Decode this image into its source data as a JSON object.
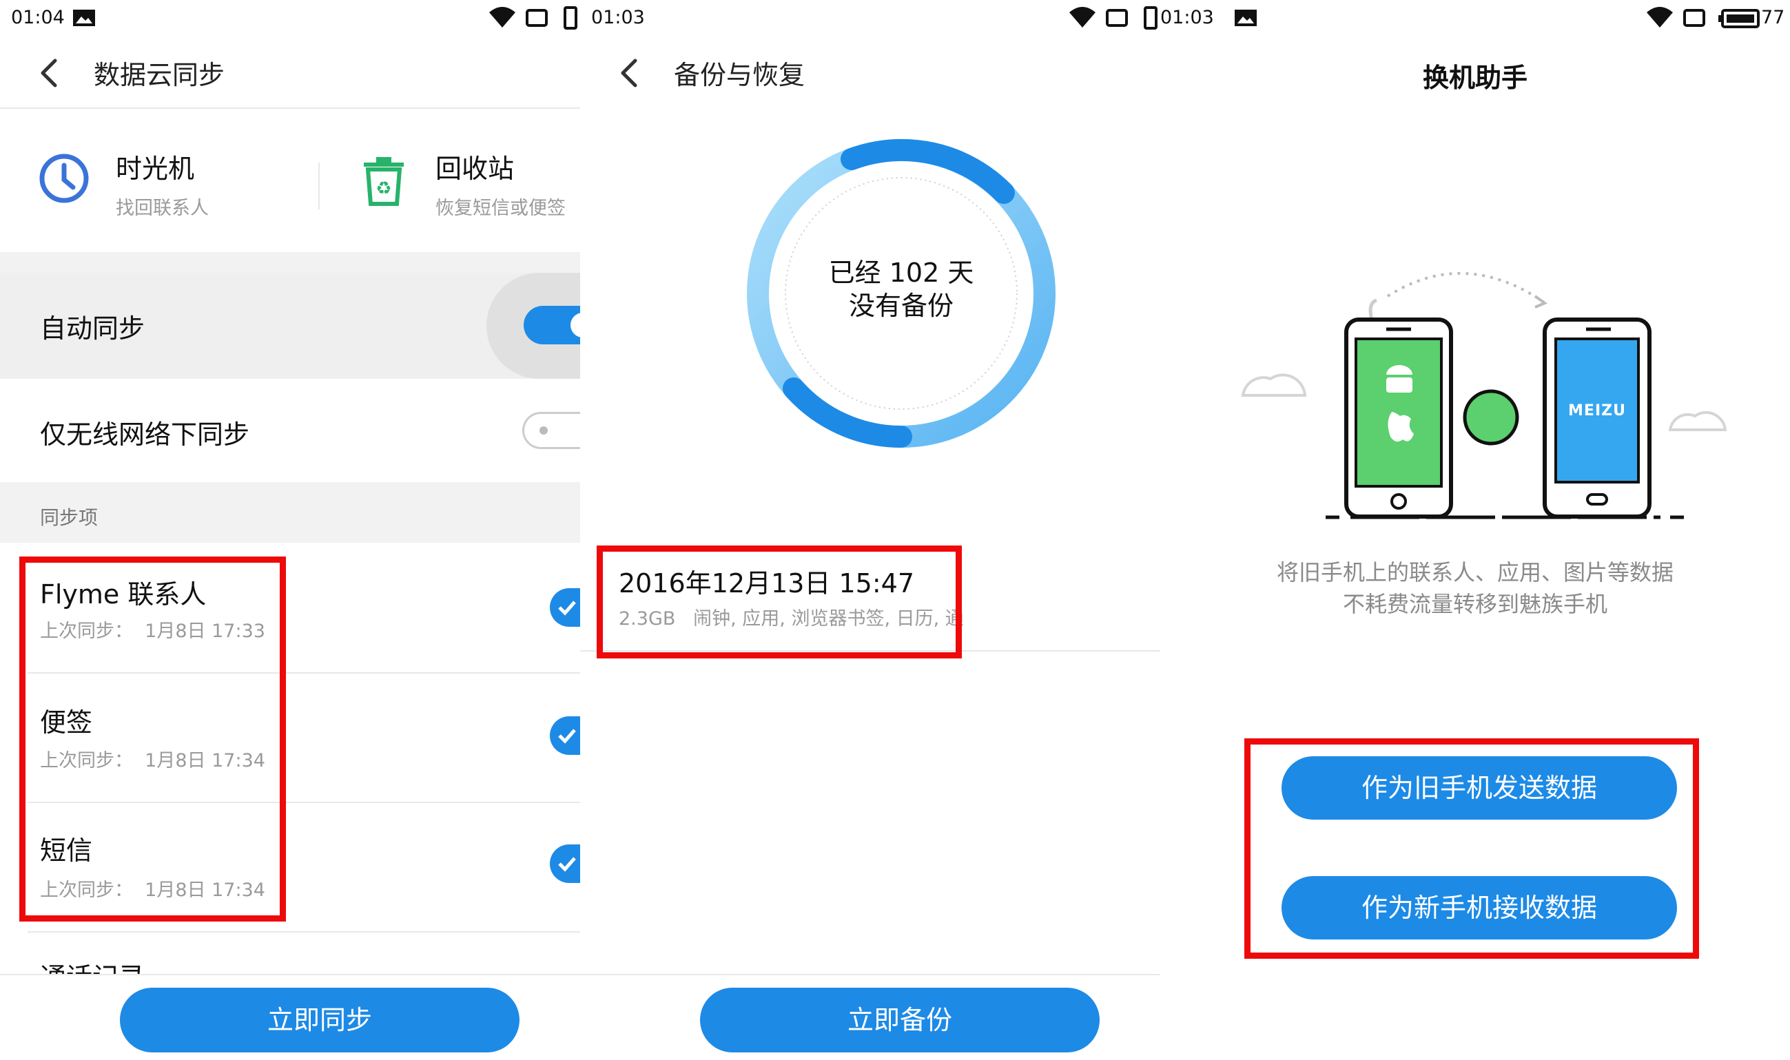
{
  "panel1": {
    "status_time": "01:04",
    "title": "数据云同步",
    "shortcuts": [
      {
        "title": "时光机",
        "subtitle": "找回联系人",
        "icon": "clock-icon"
      },
      {
        "title": "回收站",
        "subtitle": "恢复短信或便签",
        "icon": "recycle-bin-icon"
      }
    ],
    "auto_sync_label": "自动同步",
    "auto_sync_on": true,
    "wifi_only_label": "仅无线网络下同步",
    "wifi_only_on": false,
    "section_label": "同步项",
    "sync_items": [
      {
        "name": "Flyme 联系人",
        "prefix": "上次同步：",
        "time": "1月8日 17:33",
        "checked": true
      },
      {
        "name": "便签",
        "prefix": "上次同步：",
        "time": "1月8日 17:34",
        "checked": true
      },
      {
        "name": "短信",
        "prefix": "上次同步：",
        "time": "1月8日 17:34",
        "checked": true
      },
      {
        "name": "通话记录",
        "checked": true
      }
    ],
    "button_label": "立即同步"
  },
  "panel2": {
    "status_time": "01:03",
    "title": "备份与恢复",
    "ring_line1": "已经 102 天",
    "ring_line2": "没有备份",
    "backup_date": "2016年12月13日 15:47",
    "backup_size": "2.3GB",
    "backup_contents": "闹钟, 应用, 浏览器书签, 日历, 通话记录, 联...",
    "button_label": "立即备份"
  },
  "panel3": {
    "status_time": "01:03",
    "battery_text": "77",
    "title": "换机助手",
    "phone_brand": "MEIZU",
    "description_line1": "将旧手机上的联系人、应用、图片等数据",
    "description_line2": "不耗费流量转移到魅族手机",
    "send_button": "作为旧手机发送数据",
    "receive_button": "作为新手机接收数据"
  },
  "colors": {
    "accent": "#1d8ae6",
    "highlight": "#ee0a0a",
    "green": "#5ccf6e"
  }
}
